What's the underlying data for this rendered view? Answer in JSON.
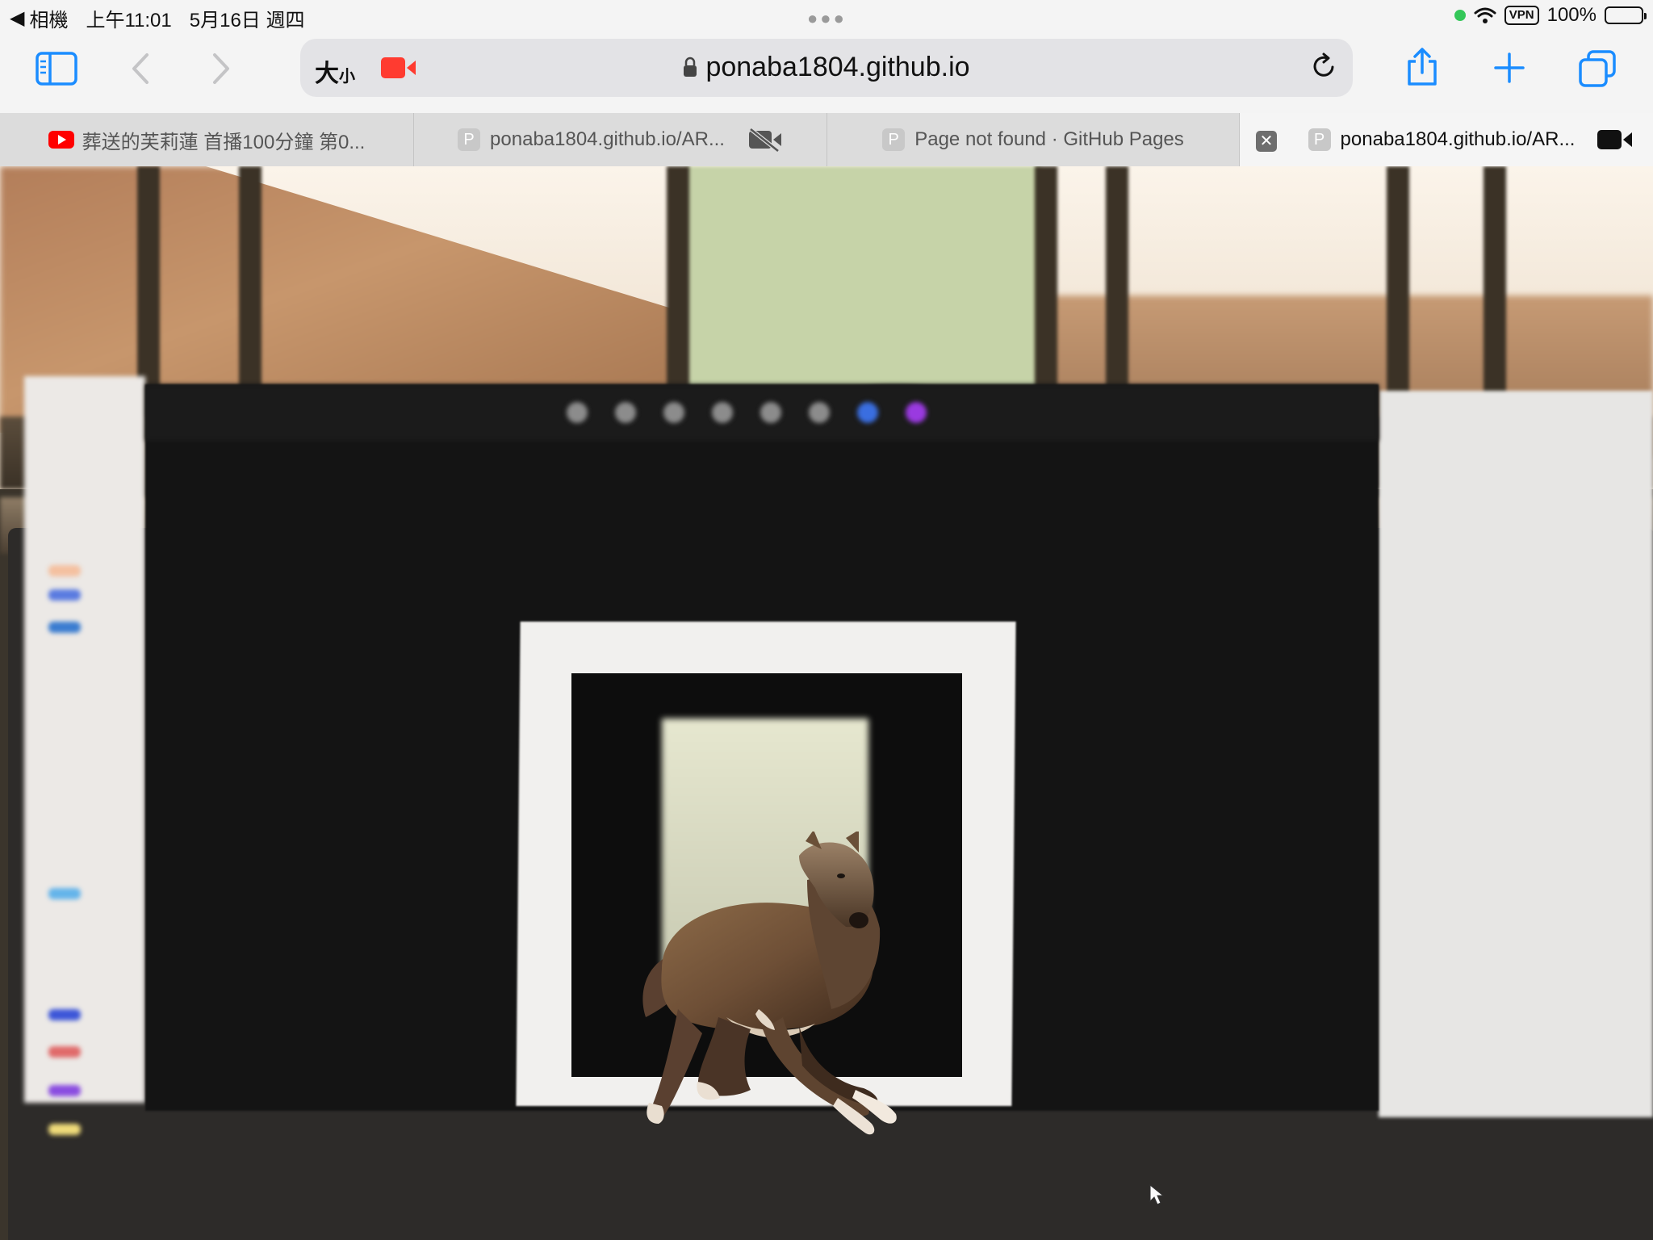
{
  "status_bar": {
    "back_label": "相機",
    "time": "上午11:01",
    "date": "5月16日 週四",
    "vpn": "VPN",
    "battery": "100%"
  },
  "toolbar": {
    "size_label": "大",
    "size_label_small": "小",
    "url": "ponaba1804.github.io"
  },
  "tabs": [
    {
      "title": "葬送的芙莉蓮 首播100分鐘 第0..."
    },
    {
      "title": "ponaba1804.github.io/AR..."
    },
    {
      "title": "Page not found · GitHub Pages"
    },
    {
      "title": "ponaba1804.github.io/AR..."
    }
  ],
  "favicon_letter": "P",
  "colors": {
    "accent": "#1a8cff",
    "recording": "#ff3b30",
    "vpn_dot": "#34c759"
  }
}
